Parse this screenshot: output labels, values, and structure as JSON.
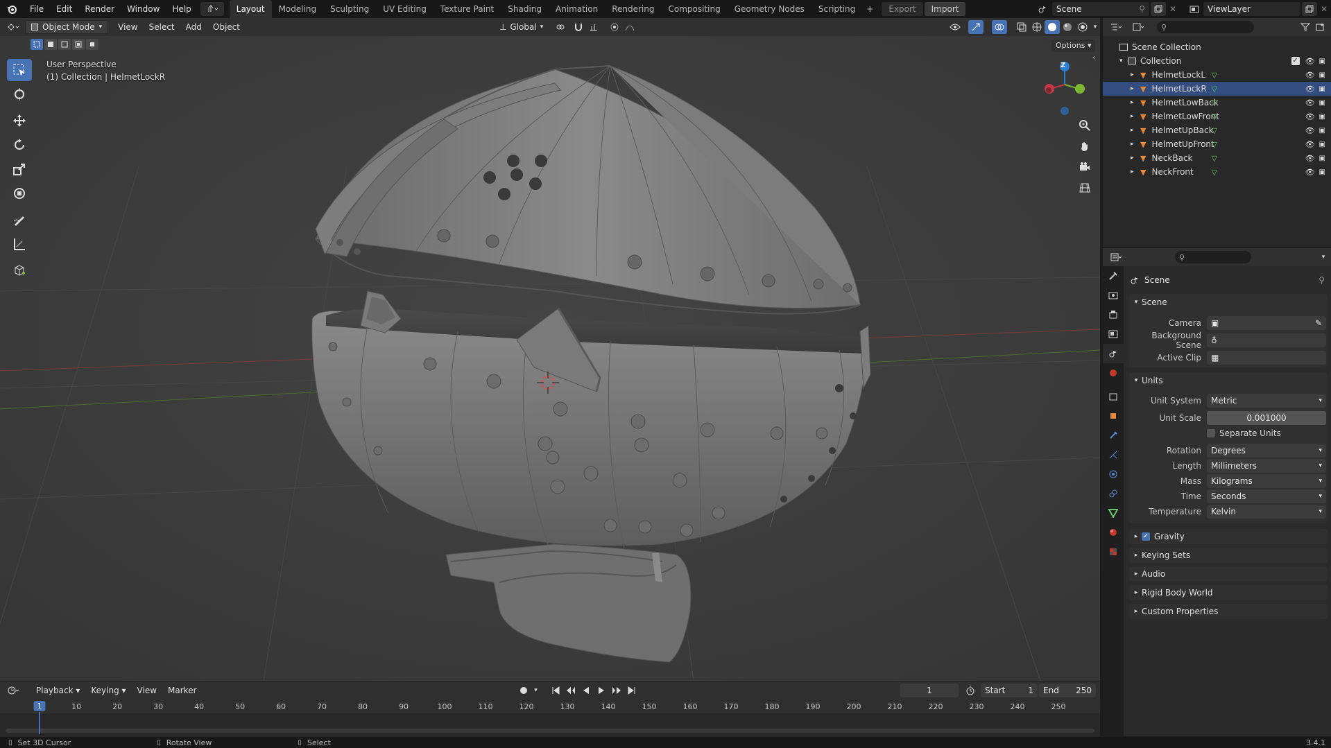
{
  "app": {
    "version": "3.4.1"
  },
  "menubar": {
    "items": [
      "File",
      "Edit",
      "Render",
      "Window",
      "Help"
    ]
  },
  "workspaces": {
    "tabs": [
      "Layout",
      "Modeling",
      "Sculpting",
      "UV Editing",
      "Texture Paint",
      "Shading",
      "Animation",
      "Rendering",
      "Compositing",
      "Geometry Nodes",
      "Scripting"
    ],
    "active": "Layout"
  },
  "toolbar_top": {
    "export_label": "Export",
    "import_label": "Import",
    "scene_name": "Scene",
    "view_layer": "ViewLayer"
  },
  "viewport_header": {
    "mode": "Object Mode",
    "menus": [
      "View",
      "Select",
      "Add",
      "Object"
    ],
    "transform_orientation": "Global",
    "options_label": "Options"
  },
  "viewport": {
    "perspective_label": "User Perspective",
    "object_label": "(1) Collection | HelmetLockR",
    "gizmo_z": "Z"
  },
  "outliner": {
    "root": "Scene Collection",
    "collection": "Collection",
    "items": [
      "HelmetLockL",
      "HelmetLockR",
      "HelmetLowBack",
      "HelmetLowFront",
      "HelmetUpBack",
      "HelmetUpFront",
      "NeckBack",
      "NeckFront"
    ],
    "colors": {
      "mesh": "#e6883a",
      "data": "#6fc26f",
      "selected": "#334d80"
    }
  },
  "properties": {
    "context_title": "Scene",
    "scene_panel": {
      "title": "Scene",
      "camera_label": "Camera",
      "background_label": "Background Scene",
      "clip_label": "Active Clip"
    },
    "units_panel": {
      "title": "Units",
      "unit_system_label": "Unit System",
      "unit_system": "Metric",
      "unit_scale_label": "Unit Scale",
      "unit_scale": "0.001000",
      "separate_units_label": "Separate Units",
      "rotation_label": "Rotation",
      "rotation": "Degrees",
      "length_label": "Length",
      "length": "Millimeters",
      "mass_label": "Mass",
      "mass": "Kilograms",
      "time_label": "Time",
      "time": "Seconds",
      "temperature_label": "Temperature",
      "temperature": "Kelvin"
    },
    "collapsed_panels": [
      "Gravity",
      "Keying Sets",
      "Audio",
      "Rigid Body World",
      "Custom Properties"
    ],
    "gravity_checked": true
  },
  "timeline": {
    "menus": [
      "Playback",
      "Keying",
      "View",
      "Marker"
    ],
    "current_frame": "1",
    "start_label": "Start",
    "start": "1",
    "end_label": "End",
    "end": "250",
    "ticks": [
      "1",
      "10",
      "20",
      "30",
      "40",
      "50",
      "60",
      "70",
      "80",
      "90",
      "100",
      "110",
      "120",
      "130",
      "140",
      "150",
      "160",
      "170",
      "180",
      "190",
      "200",
      "210",
      "220",
      "230",
      "240",
      "250"
    ]
  },
  "statusbar": {
    "left": "Set 3D Cursor",
    "middle": "Rotate View",
    "right": "Select"
  },
  "accent": "#4772b3"
}
